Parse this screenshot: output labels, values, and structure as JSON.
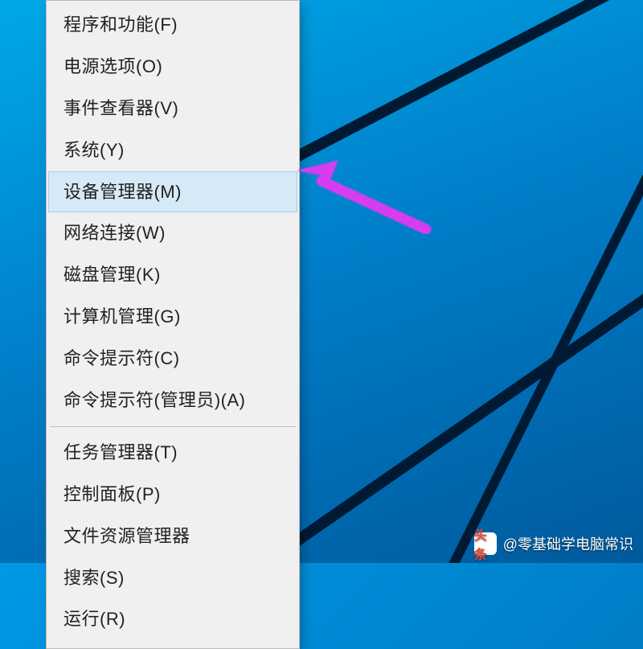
{
  "menu": {
    "groups": [
      [
        {
          "id": "programs-features",
          "label": "程序和功能(F)",
          "highlighted": false
        },
        {
          "id": "power-options",
          "label": "电源选项(O)",
          "highlighted": false
        },
        {
          "id": "event-viewer",
          "label": "事件查看器(V)",
          "highlighted": false
        },
        {
          "id": "system",
          "label": "系统(Y)",
          "highlighted": false
        },
        {
          "id": "device-manager",
          "label": "设备管理器(M)",
          "highlighted": true
        },
        {
          "id": "network-connections",
          "label": "网络连接(W)",
          "highlighted": false
        },
        {
          "id": "disk-management",
          "label": "磁盘管理(K)",
          "highlighted": false
        },
        {
          "id": "computer-management",
          "label": "计算机管理(G)",
          "highlighted": false
        },
        {
          "id": "command-prompt",
          "label": "命令提示符(C)",
          "highlighted": false
        },
        {
          "id": "command-prompt-admin",
          "label": "命令提示符(管理员)(A)",
          "highlighted": false
        }
      ],
      [
        {
          "id": "task-manager",
          "label": "任务管理器(T)",
          "highlighted": false
        },
        {
          "id": "control-panel",
          "label": "控制面板(P)",
          "highlighted": false
        },
        {
          "id": "file-explorer",
          "label": "文件资源管理器",
          "highlighted": false
        },
        {
          "id": "search",
          "label": "搜索(S)",
          "highlighted": false
        },
        {
          "id": "run",
          "label": "运行(R)",
          "highlighted": false
        }
      ]
    ]
  },
  "watermark": {
    "logo_text": "头条",
    "text": "@零基础学电脑常识"
  },
  "colors": {
    "menu_bg": "#f0f0f0",
    "highlight_bg": "#d5e9f7",
    "highlight_border": "#a6cde8",
    "arrow": "#d63cf0",
    "desktop_line": "#001a33"
  }
}
